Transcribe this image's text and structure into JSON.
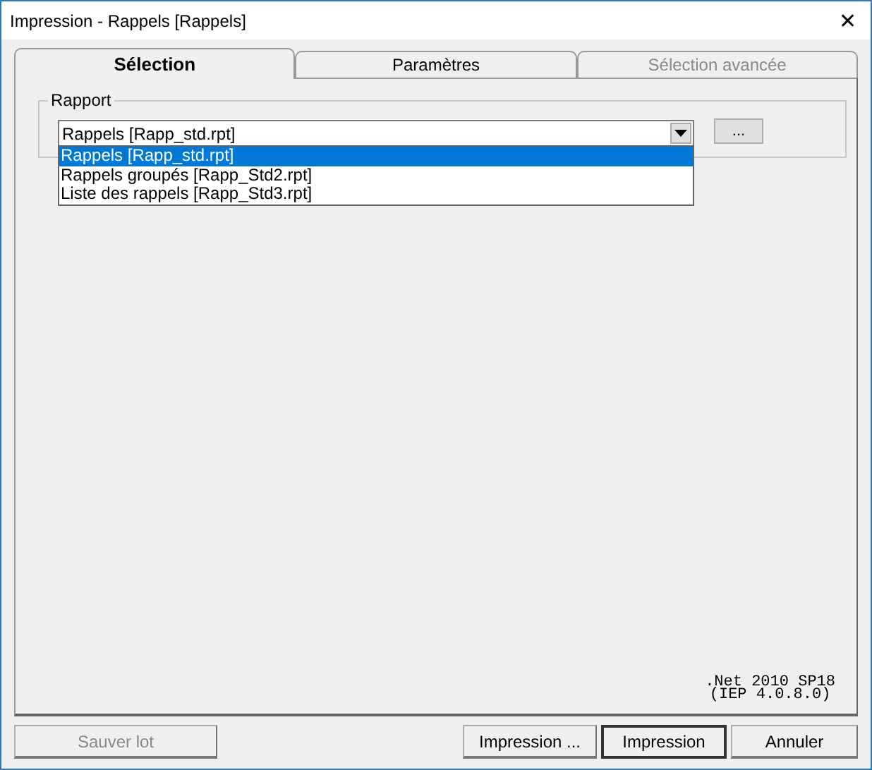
{
  "window": {
    "title": "Impression - Rappels [Rappels]",
    "close": "✕"
  },
  "tabs": [
    {
      "label": "Sélection",
      "selected": true,
      "disabled": false
    },
    {
      "label": "Paramètres",
      "selected": false,
      "disabled": false
    },
    {
      "label": "Sélection avancée",
      "selected": false,
      "disabled": true
    }
  ],
  "report_group": {
    "label": "Rapport",
    "combo_value": "Rappels [Rapp_std.rpt]",
    "browse_button": "...",
    "dropdown": [
      {
        "label": "Rappels [Rapp_std.rpt]",
        "selected": true
      },
      {
        "label": "Rappels groupés [Rapp_Std2.rpt]",
        "selected": false
      },
      {
        "label": "Liste des rappels [Rapp_Std3.rpt]",
        "selected": false
      }
    ]
  },
  "version": [
    ".Net 2010 SP18",
    "(IEP 4.0.8.0)"
  ],
  "buttons": [
    {
      "label": "Sauver lot",
      "disabled": true,
      "default": false
    },
    {
      "label": "Impression ...",
      "disabled": false,
      "default": false
    },
    {
      "label": "Impression",
      "disabled": false,
      "default": true
    },
    {
      "label": "Annuler",
      "disabled": false,
      "default": false
    }
  ]
}
